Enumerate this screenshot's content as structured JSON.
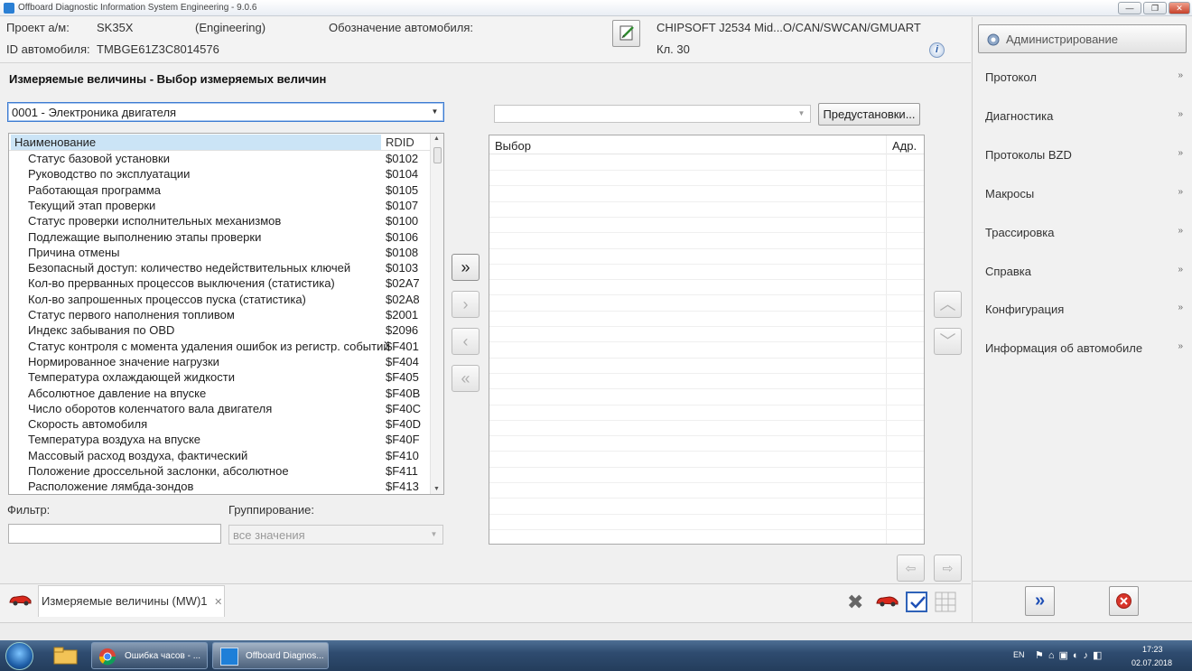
{
  "window": {
    "title": "Offboard Diagnostic Information System Engineering - 9.0.6"
  },
  "header": {
    "project_label": "Проект а/м:",
    "project_value": "SK35X",
    "project_mode": "(Engineering)",
    "vehicle_designation_label": "Обозначение автомобиля:",
    "vin_label": "ID автомобиля:",
    "vin_value": "TMBGE61Z3C8014576",
    "interface": "CHIPSOFT J2534 Mid...O/CAN/SWCAN/GMUART",
    "terminal": "Кл. 30"
  },
  "main": {
    "title": "Измеряемые величины - Выбор измеряемых величин",
    "ecu_select": "0001 - Электроника двигателя",
    "preset_select": "",
    "preset_button": "Предустановки...",
    "list_columns": {
      "name": "Наименование",
      "rdid": "RDID"
    },
    "items": [
      {
        "name": "Статус базовой установки",
        "rdid": "$0102"
      },
      {
        "name": "Руководство по эксплуатации",
        "rdid": "$0104"
      },
      {
        "name": "Работающая программа",
        "rdid": "$0105"
      },
      {
        "name": "Текущий этап проверки",
        "rdid": "$0107"
      },
      {
        "name": "Статус проверки исполнительных механизмов",
        "rdid": "$0100"
      },
      {
        "name": "Подлежащие выполнению этапы проверки",
        "rdid": "$0106"
      },
      {
        "name": "Причина отмены",
        "rdid": "$0108"
      },
      {
        "name": "Безопасный доступ: количество недействительных ключей",
        "rdid": "$0103"
      },
      {
        "name": "Кол-во прерванных процессов выключения (статистика)",
        "rdid": "$02A7"
      },
      {
        "name": "Кол-во запрошенных процессов пуска (статистика)",
        "rdid": "$02A8"
      },
      {
        "name": "Статус первого наполнения топливом",
        "rdid": "$2001"
      },
      {
        "name": "Индекс забывания по OBD",
        "rdid": "$2096"
      },
      {
        "name": "Статус контроля с момента удаления ошибок из регистр. событий",
        "rdid": "$F401"
      },
      {
        "name": "Нормированное значение нагрузки",
        "rdid": "$F404"
      },
      {
        "name": "Температура охлаждающей жидкости",
        "rdid": "$F405"
      },
      {
        "name": "Абсолютное давление на впуске",
        "rdid": "$F40B"
      },
      {
        "name": "Число оборотов коленчатого вала двигателя",
        "rdid": "$F40C"
      },
      {
        "name": "Скорость автомобиля",
        "rdid": "$F40D"
      },
      {
        "name": "Температура воздуха на впуске",
        "rdid": "$F40F"
      },
      {
        "name": "Массовый расход воздуха, фактический",
        "rdid": "$F410"
      },
      {
        "name": "Положение дроссельной заслонки, абсолютное",
        "rdid": "$F411"
      },
      {
        "name": "Расположение лямбда-зондов",
        "rdid": "$F413"
      }
    ],
    "selection_columns": {
      "choice": "Выбор",
      "addr": "Адр."
    },
    "filter_label": "Фильтр:",
    "filter_value": "",
    "grouping_label": "Группирование:",
    "grouping_value": "все значения"
  },
  "sidebar": {
    "admin_button": "Администрирование",
    "items": [
      {
        "label": "Протокол"
      },
      {
        "label": "Диагностика"
      },
      {
        "label": "Протоколы BZD"
      },
      {
        "label": "Макросы"
      },
      {
        "label": "Трассировка"
      },
      {
        "label": "Справка"
      },
      {
        "label": "Конфигурация"
      },
      {
        "label": "Информация об автомобиле"
      }
    ]
  },
  "tabs": [
    {
      "label": "Измеряемые величины (MW)1"
    }
  ],
  "taskbar": {
    "tasks": [
      {
        "label": "Ошибка часов - ..."
      },
      {
        "label": "Offboard Diagnos..."
      }
    ],
    "lang": "EN",
    "time": "17:23",
    "date": "02.07.2018"
  },
  "colors": {
    "accent": "#3d7bd1",
    "header_highlight": "#cbe4f6",
    "taskbar": "#2f4c70"
  }
}
